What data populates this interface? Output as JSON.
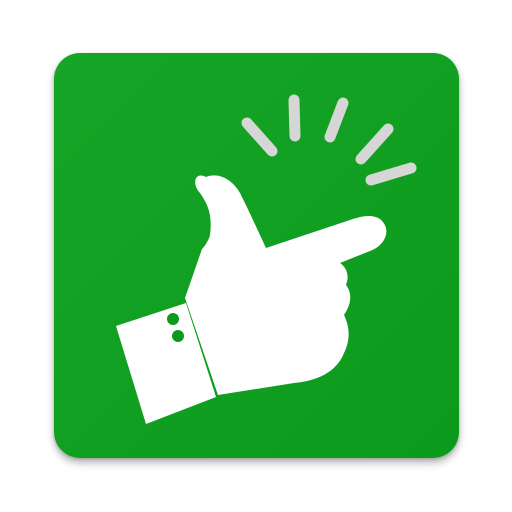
{
  "app_icon": {
    "icon": "pointing-hand-icon",
    "background_color": "#0c9a1c",
    "background_highlight": "#16a526",
    "hand_color": "#ffffff",
    "cuff_button_color": "#0c9a1c",
    "motion_lines_color": "#d6d6d6"
  }
}
